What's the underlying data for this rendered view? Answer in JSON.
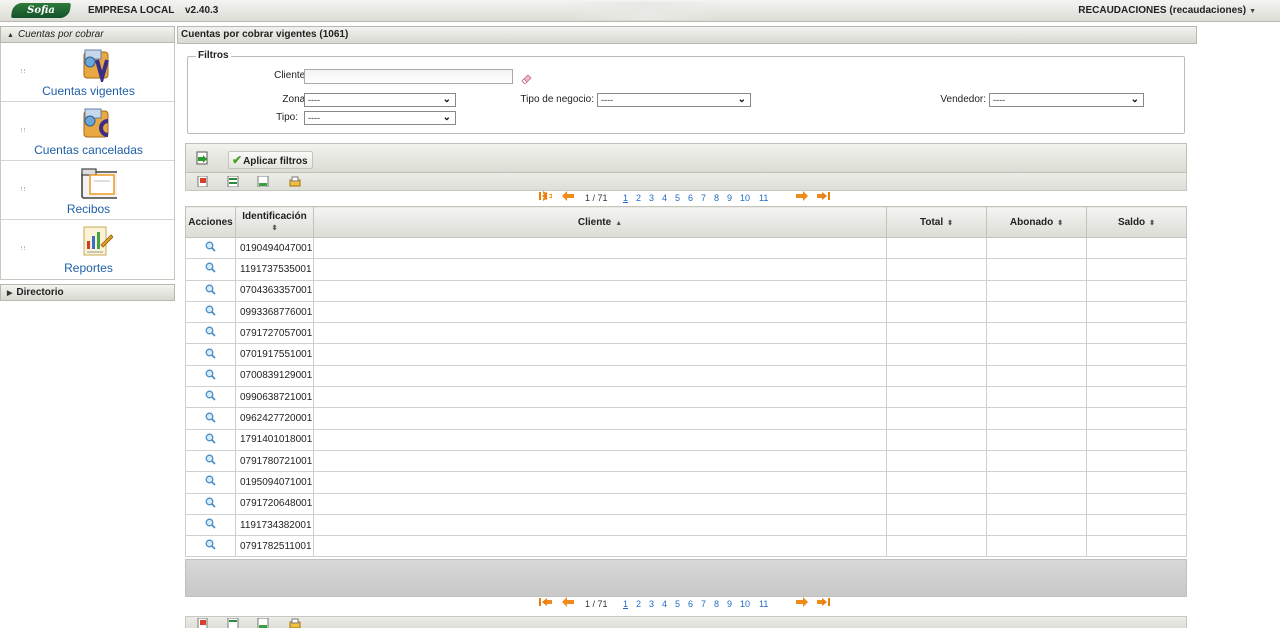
{
  "topbar": {
    "logo": "Sofia",
    "company": "EMPRESA LOCAL",
    "version": "v2.40.3",
    "user": "RECAUDACIONES (recaudaciones)"
  },
  "sidebar": {
    "section_title": "Cuentas por cobrar",
    "items": [
      {
        "label": "Cuentas vigentes",
        "icon": "accounts-active-icon"
      },
      {
        "label": "Cuentas canceladas",
        "icon": "accounts-cancelled-icon"
      },
      {
        "label": "Recibos",
        "icon": "folder-icon"
      },
      {
        "label": "Reportes",
        "icon": "report-chart-icon"
      }
    ],
    "directory_title": "Directorio"
  },
  "main": {
    "title": "Cuentas por cobrar vigentes (1061)",
    "filters": {
      "legend": "Filtros",
      "cliente_label": "Cliente:",
      "cliente_value": "",
      "zona_label": "Zona:",
      "zona_value": "----",
      "tipo_negocio_label": "Tipo de negocio:",
      "tipo_negocio_value": "----",
      "vendedor_label": "Vendedor:",
      "vendedor_value": "----",
      "tipo_label": "Tipo:",
      "tipo_value": "----"
    },
    "toolbar": {
      "apply_label": "Aplicar filtros"
    },
    "pager": {
      "info": "1 / 71",
      "pages": [
        "1",
        "2",
        "3",
        "4",
        "5",
        "6",
        "7",
        "8",
        "9",
        "10",
        "11"
      ],
      "current": "1"
    },
    "table": {
      "headers": {
        "acciones": "Acciones",
        "identificacion": "Identificación",
        "cliente": "Cliente",
        "total": "Total",
        "abonado": "Abonado",
        "saldo": "Saldo"
      },
      "rows": [
        {
          "id": "0190494047001"
        },
        {
          "id": "1191737535001"
        },
        {
          "id": "0704363357001"
        },
        {
          "id": "0993368776001"
        },
        {
          "id": "0791727057001"
        },
        {
          "id": "0701917551001"
        },
        {
          "id": "0700839129001"
        },
        {
          "id": "0990638721001"
        },
        {
          "id": "0962427720001"
        },
        {
          "id": "1791401018001"
        },
        {
          "id": "0791780721001"
        },
        {
          "id": "0195094071001"
        },
        {
          "id": "0791720648001"
        },
        {
          "id": "1191734382001"
        },
        {
          "id": "0791782511001"
        }
      ]
    }
  }
}
